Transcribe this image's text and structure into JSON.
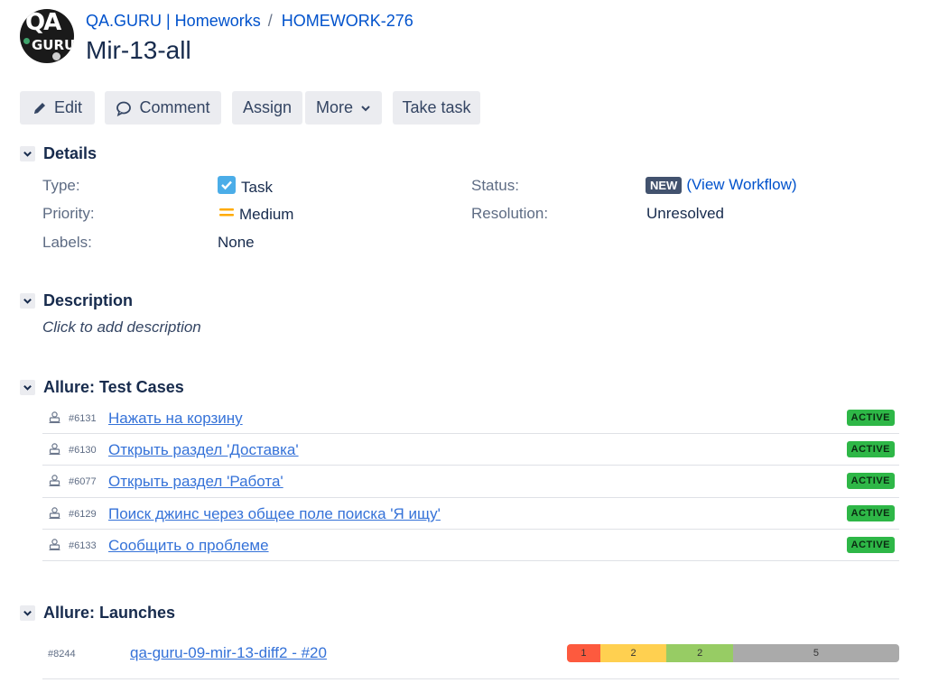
{
  "project": {
    "avatar_text_top": "QA",
    "avatar_text_bottom": "GURU"
  },
  "breadcrumbs": [
    {
      "label": "QA.GURU | Homeworks"
    },
    {
      "label": "HOMEWORK-276"
    }
  ],
  "breadcrumb_separator": "/",
  "issue": {
    "title": "Mir-13-all"
  },
  "toolbar": {
    "edit_label": "Edit",
    "comment_label": "Comment",
    "assign_label": "Assign",
    "more_label": "More",
    "take_task_label": "Take task"
  },
  "details": {
    "section_title": "Details",
    "type_label": "Type:",
    "type_value": "Task",
    "priority_label": "Priority:",
    "priority_value": "Medium",
    "labels_label": "Labels:",
    "labels_value": "None",
    "status_label": "Status:",
    "status_value": "NEW",
    "view_workflow_label": "(View Workflow)",
    "resolution_label": "Resolution:",
    "resolution_value": "Unresolved"
  },
  "description": {
    "section_title": "Description",
    "placeholder": "Click to add description"
  },
  "test_cases": {
    "section_title": "Allure: Test Cases",
    "items": [
      {
        "id": "#6131",
        "name": "Нажать на корзину",
        "status": "ACTIVE"
      },
      {
        "id": "#6130",
        "name": "Открыть раздел 'Доставка'",
        "status": "ACTIVE"
      },
      {
        "id": "#6077",
        "name": "Открыть раздел 'Работа'",
        "status": "ACTIVE"
      },
      {
        "id": "#6129",
        "name": "Поиск джинс через общее поле поиска 'Я ищу'",
        "status": "ACTIVE"
      },
      {
        "id": "#6133",
        "name": "Сообщить о проблеме",
        "status": "ACTIVE"
      }
    ]
  },
  "launches": {
    "section_title": "Allure: Launches",
    "items": [
      {
        "id": "#8244",
        "name": "qa-guru-09-mir-13-diff2 - #20",
        "stats": [
          {
            "status": "failed",
            "count": "1",
            "color": "#fd5a3e"
          },
          {
            "status": "broken",
            "count": "2",
            "color": "#ffd050"
          },
          {
            "status": "passed",
            "count": "2",
            "color": "#97cc64"
          },
          {
            "status": "unknown",
            "count": "5",
            "color": "#aaaaaa"
          }
        ]
      }
    ]
  },
  "colors": {
    "link": "#0052cc",
    "status_active": "#2eb747",
    "lozenge_new": "#42526e",
    "priority_medium": "#ffab00",
    "task_icon": "#4bade8"
  }
}
